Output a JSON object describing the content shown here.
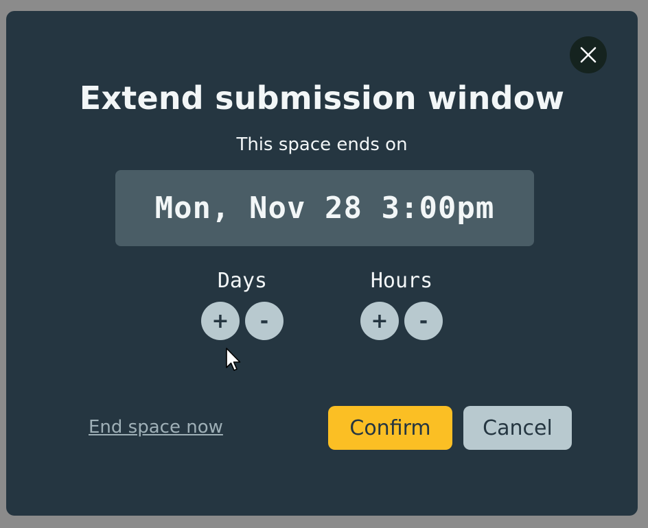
{
  "modal": {
    "title": "Extend submission window",
    "subtitle": "This space ends on",
    "end_date": "Mon, Nov 28 3:00pm",
    "close_icon": "close-icon"
  },
  "steppers": {
    "days": {
      "label": "Days",
      "plus": "+",
      "minus": "-"
    },
    "hours": {
      "label": "Hours",
      "plus": "+",
      "minus": "-"
    }
  },
  "actions": {
    "end_now": "End space now",
    "confirm": "Confirm",
    "cancel": "Cancel"
  },
  "colors": {
    "modal_bg": "#253641",
    "date_box_bg": "#4a5d66",
    "round_button_bg": "#b8c9cf",
    "confirm_bg": "#fbbf24",
    "close_bg": "#15231f",
    "overlay_bg": "#8b8b8b"
  }
}
